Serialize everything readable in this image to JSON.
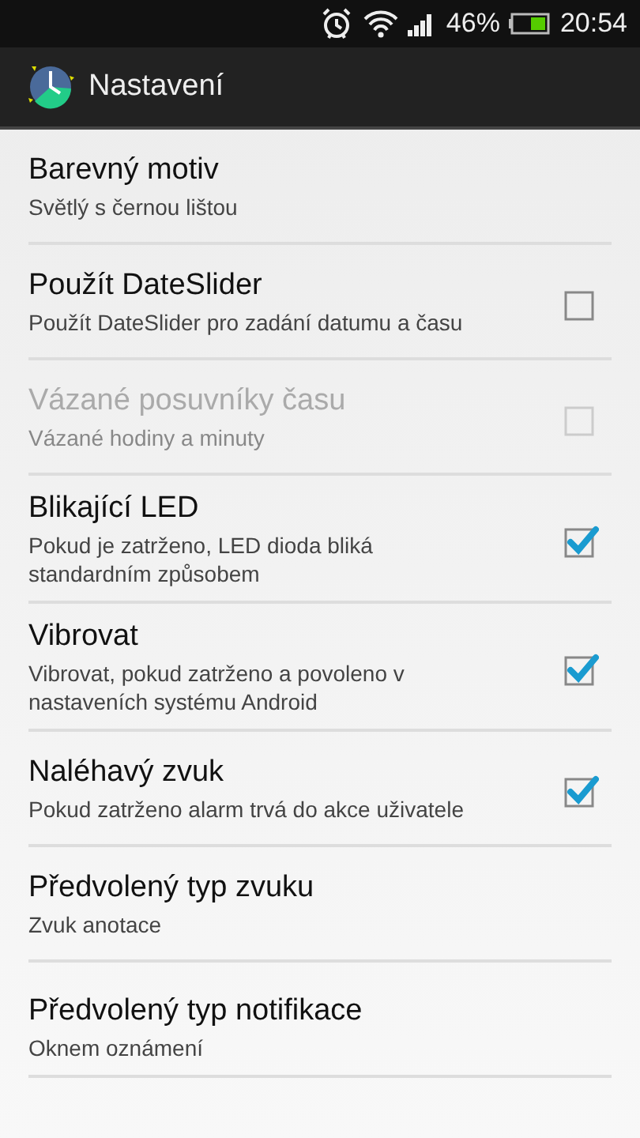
{
  "status_bar": {
    "battery": "46%",
    "time": "20:54"
  },
  "action_bar": {
    "title": "Nastavení"
  },
  "items": [
    {
      "kind": "plain",
      "title": "Barevný motiv",
      "summary": "Světlý s černou lištou",
      "disabled": false
    },
    {
      "kind": "checkbox",
      "title": "Použít DateSlider",
      "summary": "Použít DateSlider pro zadání datumu a času",
      "checked": false,
      "disabled": false
    },
    {
      "kind": "checkbox",
      "title": "Vázané posuvníky času",
      "summary": "Vázané hodiny a minuty",
      "checked": false,
      "disabled": true
    },
    {
      "kind": "checkbox",
      "title": "Blikající LED",
      "summary": "Pokud je zatrženo, LED dioda bliká standardním způsobem",
      "checked": true,
      "disabled": false
    },
    {
      "kind": "checkbox",
      "title": "Vibrovat",
      "summary": "Vibrovat, pokud zatrženo a povoleno v nastaveních systému Android",
      "checked": true,
      "disabled": false
    },
    {
      "kind": "checkbox",
      "title": "Naléhavý zvuk",
      "summary": "Pokud zatrženo alarm trvá do akce uživatele",
      "checked": true,
      "disabled": false
    },
    {
      "kind": "plain",
      "title": "Předvolený typ zvuku",
      "summary": "Zvuk anotace",
      "disabled": false
    },
    {
      "kind": "plain",
      "title": "Předvolený typ notifikace",
      "summary": "Oknem oznámení",
      "disabled": false
    }
  ]
}
